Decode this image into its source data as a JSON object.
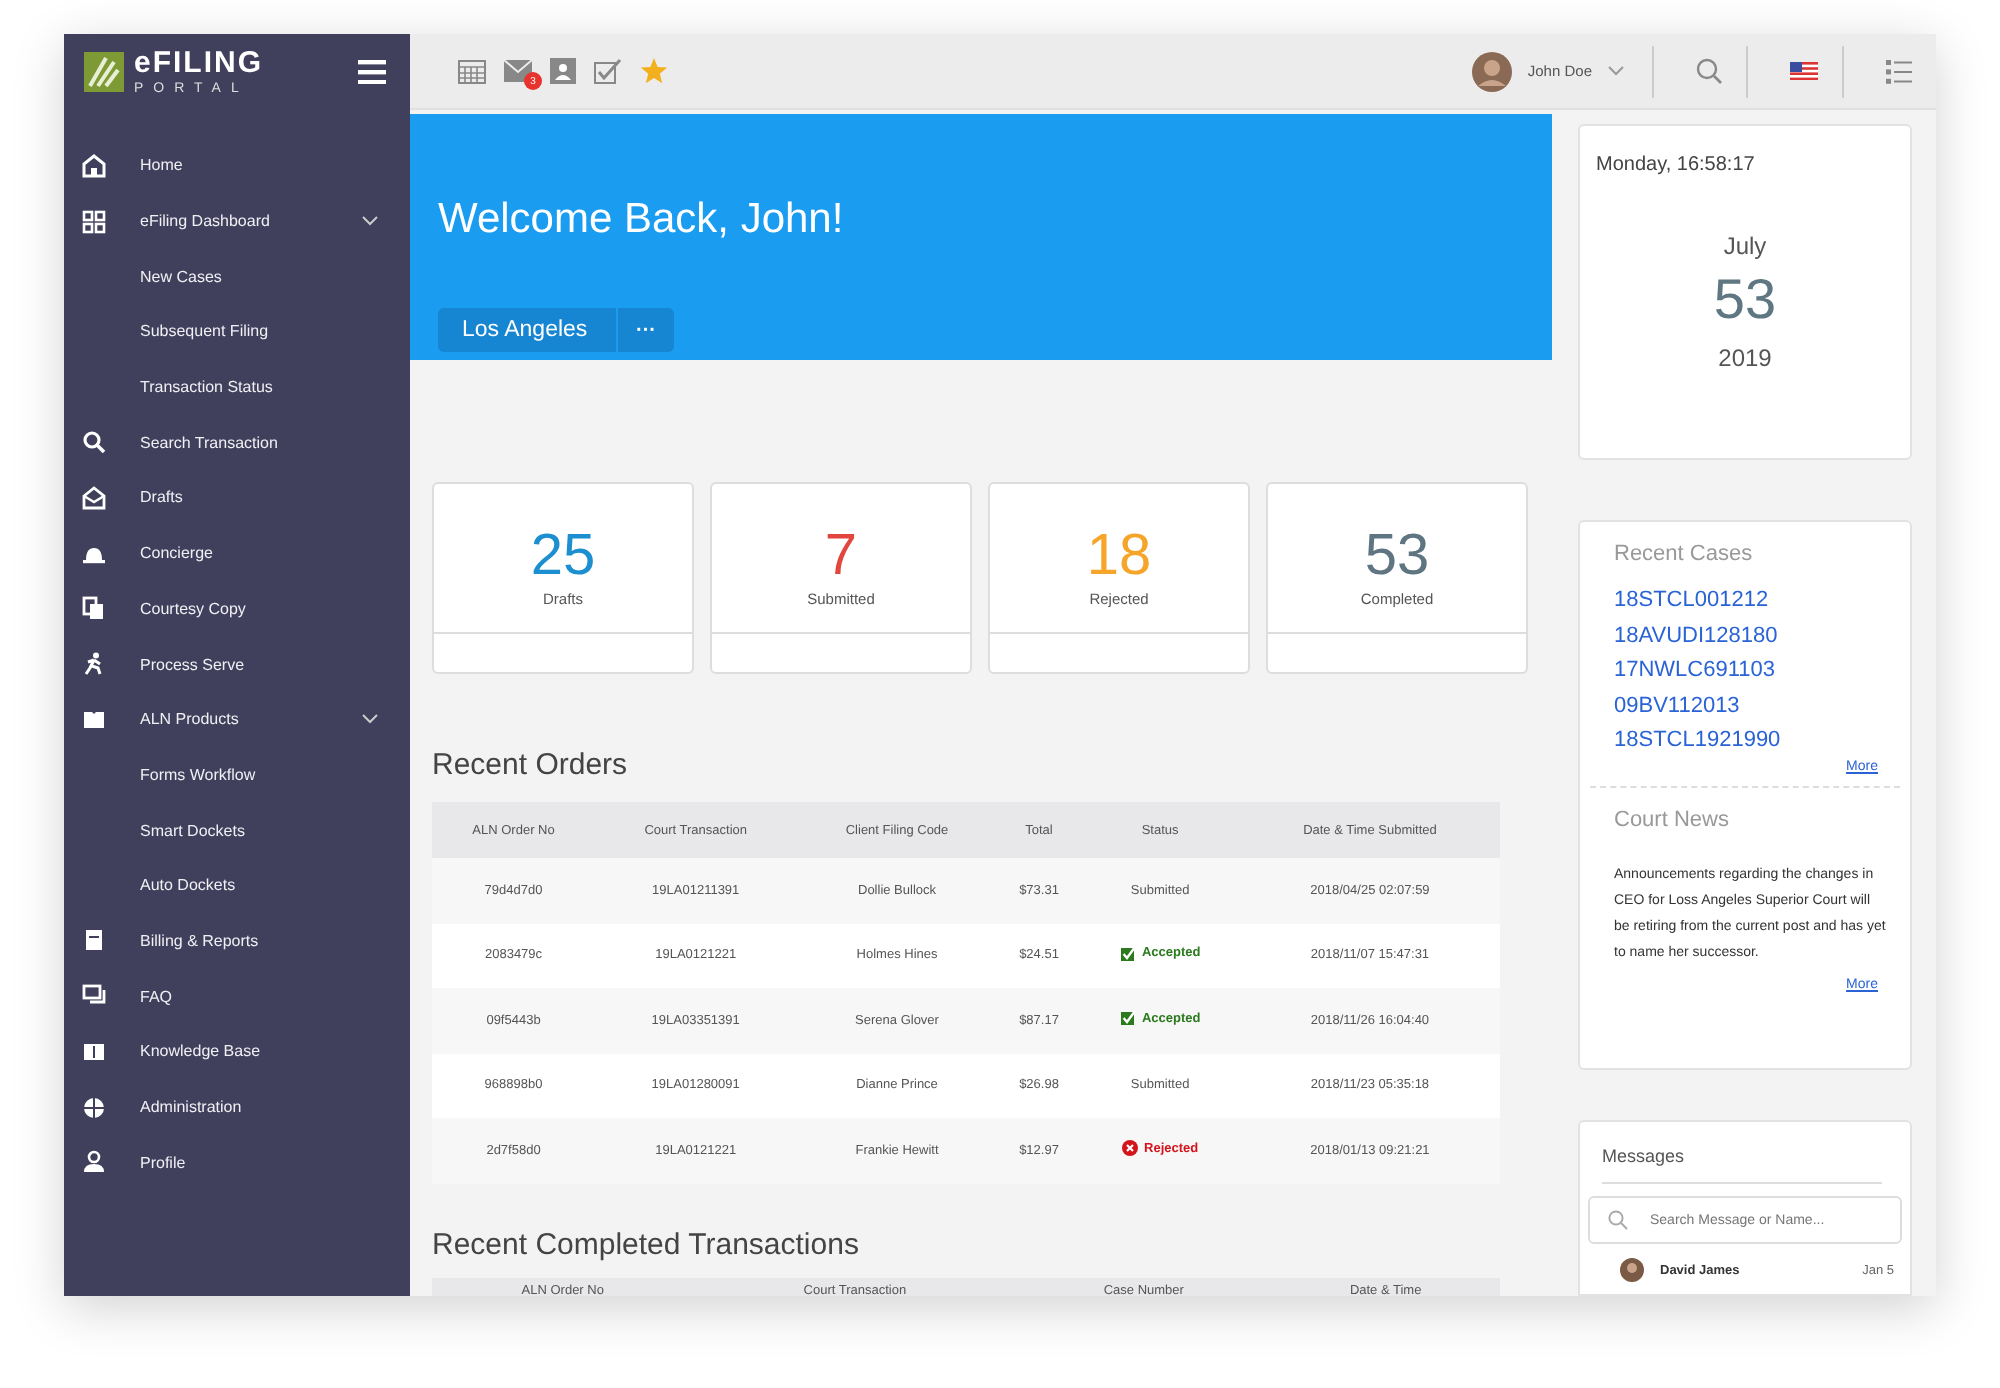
{
  "sidebar": {
    "logo": {
      "title": "eFILING",
      "subtitle": "PORTAL"
    },
    "items": [
      {
        "label": "Home"
      },
      {
        "label": "eFiling Dashboard",
        "expanded": true,
        "children": [
          {
            "label": "New Cases"
          },
          {
            "label": "Subsequent Filing"
          },
          {
            "label": "Transaction Status"
          }
        ]
      },
      {
        "label": "Search Transaction"
      },
      {
        "label": "Drafts"
      },
      {
        "label": "Concierge"
      },
      {
        "label": "Courtesy Copy"
      },
      {
        "label": "Process Serve"
      },
      {
        "label": "ALN Products",
        "expanded": true,
        "children": [
          {
            "label": "Forms Workflow"
          },
          {
            "label": "Smart Dockets"
          },
          {
            "label": "Auto Dockets"
          }
        ]
      },
      {
        "label": "Billing & Reports"
      },
      {
        "label": "FAQ"
      },
      {
        "label": "Knowledge Base"
      },
      {
        "label": "Administration"
      },
      {
        "label": "Profile"
      }
    ]
  },
  "topbar": {
    "mail_badge": "3",
    "user": "John Doe"
  },
  "welcome": {
    "title": "Welcome Back, John!",
    "location": "Los Angeles",
    "more": "···"
  },
  "stats": [
    {
      "value": "25",
      "label": "Drafts",
      "color": "#1b8fcf"
    },
    {
      "value": "7",
      "label": "Submitted",
      "color": "#e2463d"
    },
    {
      "value": "18",
      "label": "Rejected",
      "color": "#f5a52a"
    },
    {
      "value": "53",
      "label": "Completed",
      "color": "#5f7582"
    }
  ],
  "recent_orders": {
    "title": "Recent Orders",
    "columns": [
      "ALN Order No",
      "Court Transaction",
      "Client Filing Code",
      "Total",
      "Status",
      "Date & Time Submitted"
    ],
    "rows": [
      {
        "cells": [
          "79d4d7d0",
          "19LA01211391",
          "Dollie Bullock",
          "$73.31"
        ],
        "status": {
          "text": "Submitted",
          "kind": "submitted"
        },
        "date": "2018/04/25 02:07:59"
      },
      {
        "cells": [
          "2083479c",
          "19LA0121221",
          "Holmes Hines",
          "$24.51"
        ],
        "status": {
          "text": "Accepted",
          "kind": "accepted"
        },
        "date": "2018/11/07 15:47:31"
      },
      {
        "cells": [
          "09f5443b",
          "19LA03351391",
          "Serena Glover",
          "$87.17"
        ],
        "status": {
          "text": "Accepted",
          "kind": "accepted"
        },
        "date": "2018/11/26 16:04:40"
      },
      {
        "cells": [
          "968898b0",
          "19LA01280091",
          "Dianne Prince",
          "$26.98"
        ],
        "status": {
          "text": "Submitted",
          "kind": "submitted"
        },
        "date": "2018/11/23 05:35:18"
      },
      {
        "cells": [
          "2d7f58d0",
          "19LA0121221",
          "Frankie Hewitt",
          "$12.97"
        ],
        "status": {
          "text": "Rejected",
          "kind": "rejected"
        },
        "date": "2018/01/13 09:21:21"
      }
    ]
  },
  "recent_completed": {
    "title": "Recent Completed Transactions",
    "columns": [
      "ALN Order No",
      "Court Transaction",
      "Case Number",
      "Date & Time"
    ]
  },
  "date_card": {
    "weekday_time": "Monday, 16:58:17",
    "month": "July",
    "day": "53",
    "year": "2019"
  },
  "recent_cases": {
    "title": "Recent Cases",
    "cases": [
      "18STCL001212",
      "18AVUDI128180",
      "17NWLC691103",
      "09BV112013",
      "18STCL1921990"
    ],
    "more": "More"
  },
  "court_news": {
    "title": "Court News",
    "text": "Announcements regarding the changes in CEO for Loss Angeles Superior Court will be retiring from the current post and has yet to name her successor.",
    "more": "More"
  },
  "messages": {
    "title": "Messages",
    "search_placeholder": "Search Message or Name...",
    "items": [
      {
        "name": "David James",
        "date": "Jan 5"
      }
    ]
  }
}
